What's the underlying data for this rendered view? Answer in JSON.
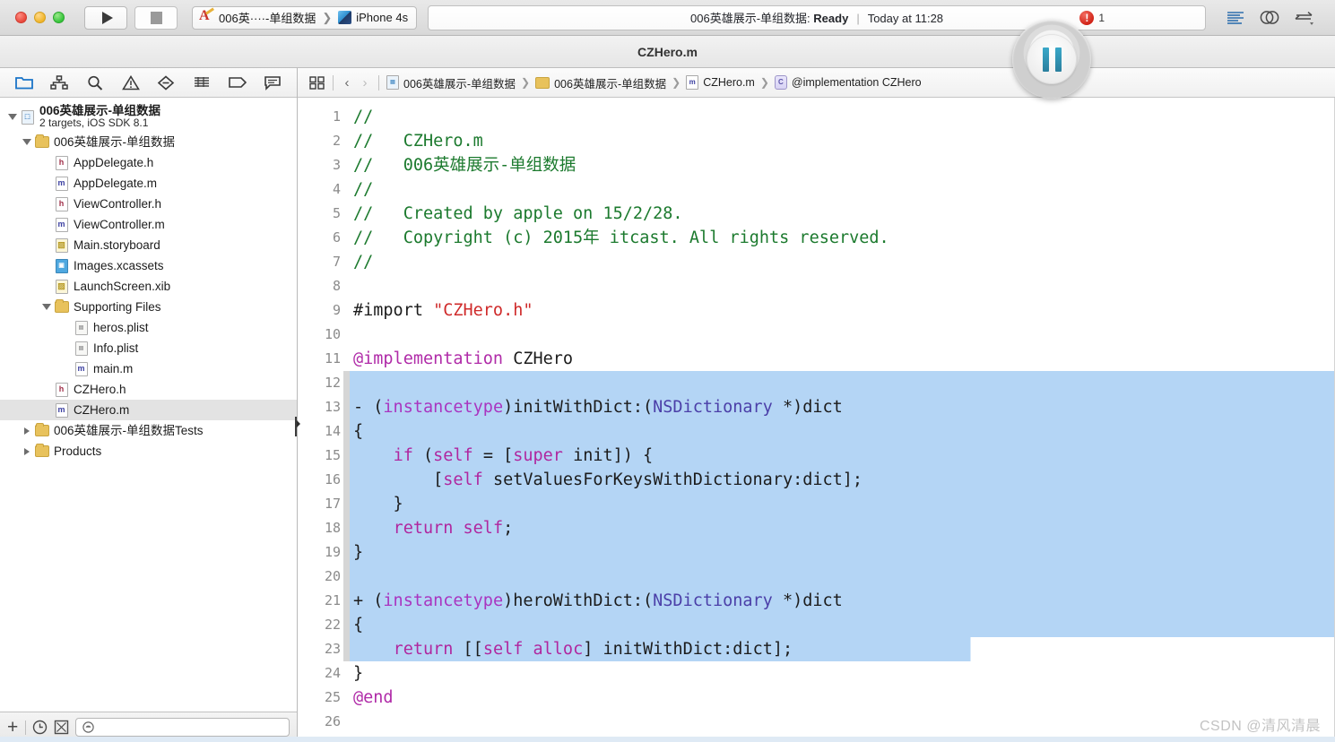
{
  "window": {
    "title": "CZHero.m"
  },
  "toolbar": {
    "run_label": "Run",
    "stop_label": "Stop",
    "scheme": "006英····-单组数据",
    "scheme_separator": "❯",
    "destination": "iPhone 4s",
    "status_prefix": "006英雄展示-单组数据: ",
    "status_state": "Ready",
    "status_divider": "|",
    "status_time": "Today at 11:28",
    "error_glyph": "!",
    "error_count": "1",
    "editor_modes": [
      "standard-editor",
      "assistant-editor",
      "version-editor"
    ]
  },
  "navigator": {
    "tabs": [
      {
        "name": "project-navigator",
        "icon": "folder-icon",
        "active": true
      },
      {
        "name": "symbol-navigator",
        "icon": "hierarchy-icon",
        "active": false
      },
      {
        "name": "find-navigator",
        "icon": "search-icon",
        "active": false
      },
      {
        "name": "issue-navigator",
        "icon": "warning-triangle-icon",
        "active": false
      },
      {
        "name": "test-navigator",
        "icon": "diamond-icon",
        "active": false
      },
      {
        "name": "debug-navigator",
        "icon": "list-icon",
        "active": false
      },
      {
        "name": "breakpoint-navigator",
        "icon": "tag-icon",
        "active": false
      },
      {
        "name": "log-navigator",
        "icon": "speech-bubble-icon",
        "active": false
      }
    ],
    "tree": [
      {
        "label": "006英雄展示-单组数据",
        "sublabel": "2 targets, iOS SDK 8.1",
        "icon": "project-icon",
        "indent": 0,
        "twisty": "open",
        "bold": true,
        "selected": false
      },
      {
        "label": "006英雄展示-单组数据",
        "icon": "folder-icon",
        "indent": 1,
        "twisty": "open",
        "bold": false,
        "selected": false
      },
      {
        "label": "AppDelegate.h",
        "icon": "header-file-icon",
        "indent": 2,
        "twisty": "none",
        "bold": false,
        "selected": false
      },
      {
        "label": "AppDelegate.m",
        "icon": "source-file-icon",
        "indent": 2,
        "twisty": "none",
        "bold": false,
        "selected": false
      },
      {
        "label": "ViewController.h",
        "icon": "header-file-icon",
        "indent": 2,
        "twisty": "none",
        "bold": false,
        "selected": false
      },
      {
        "label": "ViewController.m",
        "icon": "source-file-icon",
        "indent": 2,
        "twisty": "none",
        "bold": false,
        "selected": false
      },
      {
        "label": "Main.storyboard",
        "icon": "storyboard-icon",
        "indent": 2,
        "twisty": "none",
        "bold": false,
        "selected": false
      },
      {
        "label": "Images.xcassets",
        "icon": "asset-catalog-icon",
        "indent": 2,
        "twisty": "none",
        "bold": false,
        "selected": false
      },
      {
        "label": "LaunchScreen.xib",
        "icon": "xib-icon",
        "indent": 2,
        "twisty": "none",
        "bold": false,
        "selected": false
      },
      {
        "label": "Supporting Files",
        "icon": "folder-icon",
        "indent": 2,
        "twisty": "open",
        "bold": false,
        "selected": false
      },
      {
        "label": "heros.plist",
        "icon": "plist-icon",
        "indent": 3,
        "twisty": "none",
        "bold": false,
        "selected": false
      },
      {
        "label": "Info.plist",
        "icon": "plist-icon",
        "indent": 3,
        "twisty": "none",
        "bold": false,
        "selected": false
      },
      {
        "label": "main.m",
        "icon": "source-file-icon",
        "indent": 3,
        "twisty": "none",
        "bold": false,
        "selected": false
      },
      {
        "label": "CZHero.h",
        "icon": "header-file-icon",
        "indent": 2,
        "twisty": "none",
        "bold": false,
        "selected": false
      },
      {
        "label": "CZHero.m",
        "icon": "source-file-icon",
        "indent": 2,
        "twisty": "none",
        "bold": false,
        "selected": true
      },
      {
        "label": "006英雄展示-单组数据Tests",
        "icon": "folder-icon",
        "indent": 1,
        "twisty": "closed",
        "bold": false,
        "selected": false
      },
      {
        "label": "Products",
        "icon": "folder-icon",
        "indent": 1,
        "twisty": "closed",
        "bold": false,
        "selected": false
      }
    ],
    "bottom": {
      "add_label": "+",
      "recent_icon": "clock-icon",
      "source_control_icon": "status-filter-icon",
      "filter_placeholder": ""
    }
  },
  "jumpbar": {
    "related_icon": "related-items-icon",
    "back_label": "‹",
    "forward_label": "›",
    "crumbs": [
      {
        "label": "006英雄展示-单组数据",
        "icon": "project-icon"
      },
      {
        "label": "006英雄展示-单组数据",
        "icon": "folder-icon"
      },
      {
        "label": "CZHero.m",
        "icon": "source-file-icon"
      },
      {
        "label": "@implementation CZHero",
        "icon": "class-icon"
      }
    ],
    "chevron": "❯"
  },
  "editor": {
    "selection_color": "#b4d5f5",
    "lines": [
      {
        "n": "1",
        "sel": "none",
        "tokens": [
          {
            "t": "//",
            "c": "cmt"
          }
        ]
      },
      {
        "n": "2",
        "sel": "none",
        "tokens": [
          {
            "t": "//   CZHero.m",
            "c": "cmt"
          }
        ]
      },
      {
        "n": "3",
        "sel": "none",
        "tokens": [
          {
            "t": "//   006英雄展示-单组数据",
            "c": "cmt"
          }
        ]
      },
      {
        "n": "4",
        "sel": "none",
        "tokens": [
          {
            "t": "//",
            "c": "cmt"
          }
        ]
      },
      {
        "n": "5",
        "sel": "none",
        "tokens": [
          {
            "t": "//   Created by apple on 15/2/28.",
            "c": "cmt"
          }
        ]
      },
      {
        "n": "6",
        "sel": "none",
        "tokens": [
          {
            "t": "//   Copyright (c) 2015年 itcast. All rights reserved.",
            "c": "cmt"
          }
        ]
      },
      {
        "n": "7",
        "sel": "none",
        "tokens": [
          {
            "t": "//",
            "c": "cmt"
          }
        ]
      },
      {
        "n": "8",
        "sel": "none",
        "tokens": []
      },
      {
        "n": "9",
        "sel": "none",
        "tokens": [
          {
            "t": "#import ",
            "c": "pre"
          },
          {
            "t": "\"CZHero.h\"",
            "c": "str"
          }
        ]
      },
      {
        "n": "10",
        "sel": "none",
        "tokens": []
      },
      {
        "n": "11",
        "sel": "none",
        "tokens": [
          {
            "t": "@implementation",
            "c": "dir"
          },
          {
            "t": " CZHero",
            "c": "plain"
          }
        ]
      },
      {
        "n": "12",
        "sel": "full",
        "tokens": []
      },
      {
        "n": "13",
        "sel": "full",
        "tokens": [
          {
            "t": "- (",
            "c": "plain"
          },
          {
            "t": "instancetype",
            "c": "purp"
          },
          {
            "t": ")initWithDict:(",
            "c": "plain"
          },
          {
            "t": "NSDictionary",
            "c": "type"
          },
          {
            "t": " *)dict",
            "c": "plain"
          }
        ]
      },
      {
        "n": "14",
        "sel": "full",
        "tokens": [
          {
            "t": "{",
            "c": "plain"
          }
        ]
      },
      {
        "n": "15",
        "sel": "full",
        "tokens": [
          {
            "t": "    ",
            "c": "plain"
          },
          {
            "t": "if",
            "c": "kw"
          },
          {
            "t": " (",
            "c": "plain"
          },
          {
            "t": "self",
            "c": "kw"
          },
          {
            "t": " = [",
            "c": "plain"
          },
          {
            "t": "super",
            "c": "kw"
          },
          {
            "t": " init]) {",
            "c": "plain"
          }
        ]
      },
      {
        "n": "16",
        "sel": "full",
        "tokens": [
          {
            "t": "        [",
            "c": "plain"
          },
          {
            "t": "self",
            "c": "kw"
          },
          {
            "t": " setValuesForKeysWithDictionary:dict];",
            "c": "plain"
          }
        ]
      },
      {
        "n": "17",
        "sel": "full",
        "tokens": [
          {
            "t": "    }",
            "c": "plain"
          }
        ]
      },
      {
        "n": "18",
        "sel": "full",
        "tokens": [
          {
            "t": "    ",
            "c": "plain"
          },
          {
            "t": "return",
            "c": "kw"
          },
          {
            "t": " ",
            "c": "plain"
          },
          {
            "t": "self",
            "c": "kw"
          },
          {
            "t": ";",
            "c": "plain"
          }
        ]
      },
      {
        "n": "19",
        "sel": "full",
        "tokens": [
          {
            "t": "}",
            "c": "plain"
          }
        ]
      },
      {
        "n": "20",
        "sel": "full",
        "tokens": []
      },
      {
        "n": "21",
        "sel": "full",
        "tokens": [
          {
            "t": "+ (",
            "c": "plain"
          },
          {
            "t": "instancetype",
            "c": "purp"
          },
          {
            "t": ")heroWithDict:(",
            "c": "plain"
          },
          {
            "t": "NSDictionary",
            "c": "type"
          },
          {
            "t": " *)dict",
            "c": "plain"
          }
        ]
      },
      {
        "n": "22",
        "sel": "full",
        "tokens": [
          {
            "t": "{",
            "c": "plain"
          }
        ]
      },
      {
        "n": "23",
        "sel": "partial",
        "tokens": [
          {
            "t": "    ",
            "c": "plain"
          },
          {
            "t": "return",
            "c": "kw"
          },
          {
            "t": " [[",
            "c": "plain"
          },
          {
            "t": "self",
            "c": "kw"
          },
          {
            "t": " ",
            "c": "plain"
          },
          {
            "t": "alloc",
            "c": "kw"
          },
          {
            "t": "]",
            "c": "plain"
          },
          {
            "t": " initWithDict:dict];",
            "c": "plain"
          }
        ]
      },
      {
        "n": "24",
        "sel": "none",
        "tokens": [
          {
            "t": "}",
            "c": "plain"
          }
        ]
      },
      {
        "n": "25",
        "sel": "none",
        "tokens": [
          {
            "t": "@end",
            "c": "dir"
          }
        ]
      },
      {
        "n": "26",
        "sel": "none",
        "tokens": []
      }
    ]
  },
  "overlay": {
    "pause_button": "pause-recording-button"
  },
  "watermark": {
    "text": "CSDN @清风清晨"
  }
}
